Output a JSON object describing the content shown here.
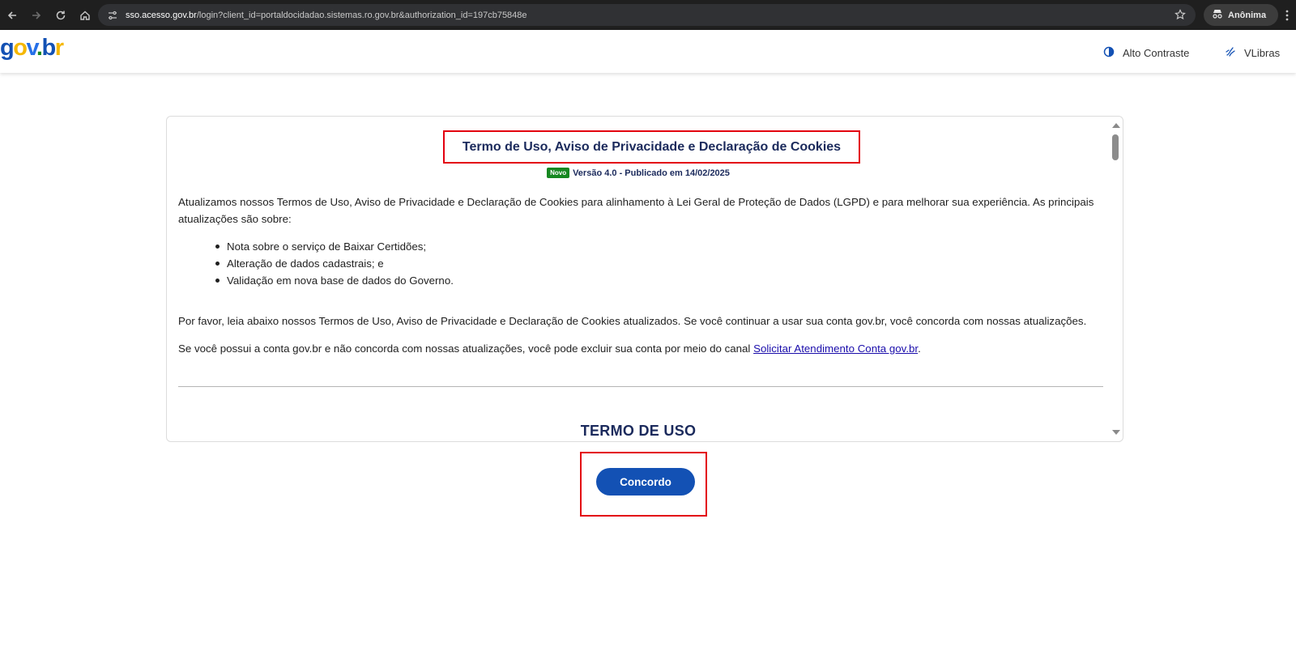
{
  "browser": {
    "url_host": "sso.acesso.gov.br",
    "url_path": "/login?client_id=portaldocidadao.sistemas.ro.gov.br&authorization_id=197cb75848e",
    "profile_label": "Anônima"
  },
  "header": {
    "high_contrast_label": "Alto Contraste",
    "vlibras_label": "VLibras"
  },
  "terms": {
    "title": "Termo de Uso, Aviso de Privacidade e Declaração de Cookies",
    "badge": "Novo",
    "version": "Versão 4.0 - Publicado em 14/02/2025",
    "intro": "Atualizamos nossos Termos de Uso, Aviso de Privacidade e Declaração de Cookies para alinhamento à Lei Geral de Proteção de Dados (LGPD) e para melhorar sua experiência. As principais atualizações são sobre:",
    "bullets": [
      "Nota sobre o serviço de Baixar Certidões;",
      "Alteração de dados cadastrais; e",
      "Validação em nova base de dados do Governo."
    ],
    "read_notice": "Por favor, leia abaixo nossos Termos de Uso, Aviso de Privacidade e Declaração de Cookies atualizados. Se você continuar a usar sua conta gov.br, você concorda com nossas atualizações.",
    "delete_notice": "Se você possui a conta gov.br e não concorda com nossas atualizações, você pode excluir sua conta por meio do canal",
    "delete_link": "Solicitar Atendimento Conta gov.br",
    "delete_suffix": ".",
    "section_title": "TERMO DE USO"
  },
  "actions": {
    "agree_label": "Concordo"
  },
  "colors": {
    "brand_blue": "#1351b4",
    "title_navy": "#1b2a5c",
    "highlight_red": "#e3000f",
    "badge_green": "#168821"
  }
}
